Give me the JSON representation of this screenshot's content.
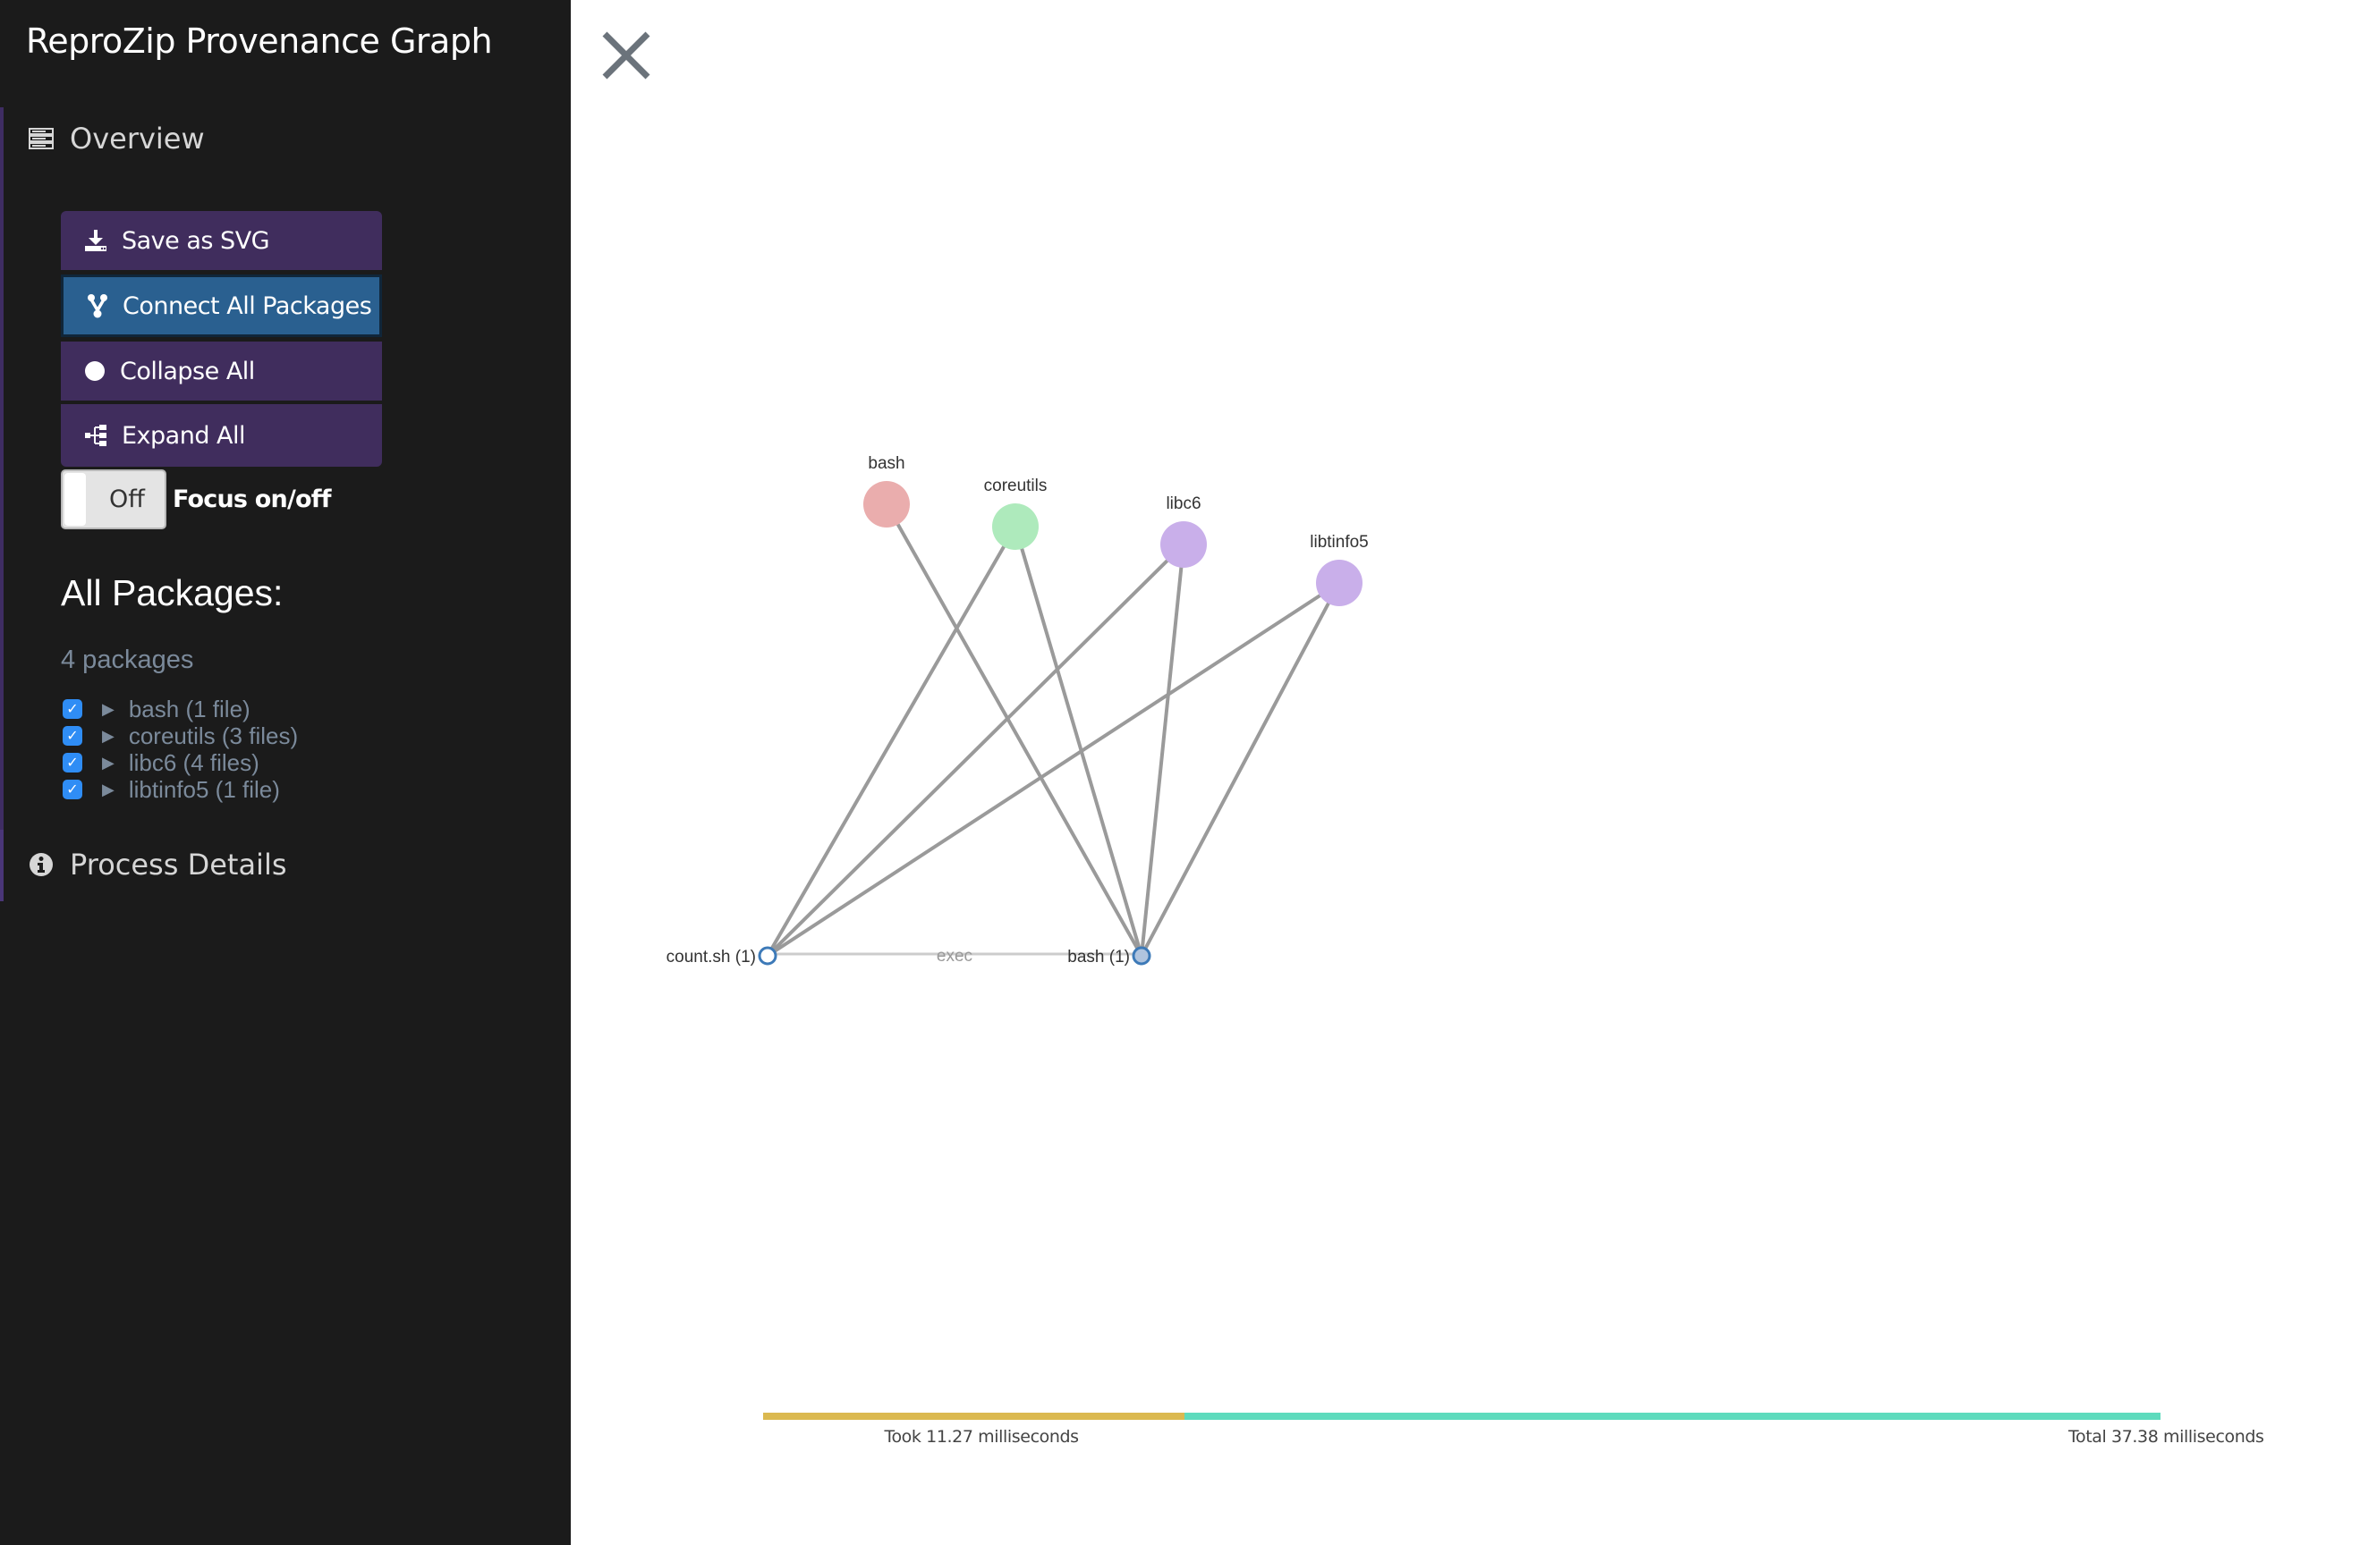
{
  "app": {
    "title": "ReproZip Provenance Graph"
  },
  "sidebar": {
    "overview_label": "Overview",
    "process_details_label": "Process Details",
    "buttons": {
      "save_svg": "Save as SVG",
      "connect_all": "Connect All Packages",
      "collapse_all": "Collapse All",
      "expand_all": "Expand All"
    },
    "focus_toggle": {
      "state_label": "Off",
      "label": "Focus on/off",
      "on": false
    },
    "packages": {
      "heading": "All Packages:",
      "count_text": "4 packages",
      "items": [
        {
          "label": "bash (1 file)",
          "checked": true
        },
        {
          "label": "coreutils (3 files)",
          "checked": true
        },
        {
          "label": "libc6 (4 files)",
          "checked": true
        },
        {
          "label": "libtinfo5 (1 file)",
          "checked": true
        }
      ]
    }
  },
  "graph": {
    "package_nodes": [
      {
        "id": "bash",
        "label": "bash",
        "color": "#eaadad"
      },
      {
        "id": "coreutils",
        "label": "coreutils",
        "color": "#aeeabc"
      },
      {
        "id": "libc6",
        "label": "libc6",
        "color": "#c9afea"
      },
      {
        "id": "libtinfo5",
        "label": "libtinfo5",
        "color": "#c9afea"
      }
    ],
    "process_nodes": [
      {
        "id": "count",
        "label": "count.sh (1)",
        "fill": "#ffffff",
        "stroke": "#3d7ab8"
      },
      {
        "id": "bash_proc",
        "label": "bash (1)",
        "fill": "#b0c4de",
        "stroke": "#3d7ab8"
      }
    ],
    "exec_edge": {
      "from": "count",
      "to": "bash_proc",
      "label": "exec"
    },
    "package_edges": [
      {
        "from": "count",
        "to": "coreutils"
      },
      {
        "from": "count",
        "to": "libc6"
      },
      {
        "from": "count",
        "to": "libtinfo5"
      },
      {
        "from": "bash_proc",
        "to": "bash"
      },
      {
        "from": "bash_proc",
        "to": "coreutils"
      },
      {
        "from": "bash_proc",
        "to": "libc6"
      },
      {
        "from": "bash_proc",
        "to": "libtinfo5"
      }
    ]
  },
  "timing": {
    "took_ms": 11.27,
    "total_ms": 37.38,
    "took_text": "Took 11.27 milliseconds",
    "total_text": "Total 37.38 milliseconds",
    "took_color": "#dbb950",
    "total_color": "#5edbbd"
  },
  "icons": {
    "close": "close-icon",
    "overview": "server-icon",
    "process_details": "info-circle-icon",
    "save_svg": "download-icon",
    "connect_all": "code-fork-icon",
    "collapse_all": "circle-icon",
    "expand_all": "sitemap-icon",
    "package_expander": "caret-right-icon",
    "checkbox_checked": "check-icon"
  }
}
